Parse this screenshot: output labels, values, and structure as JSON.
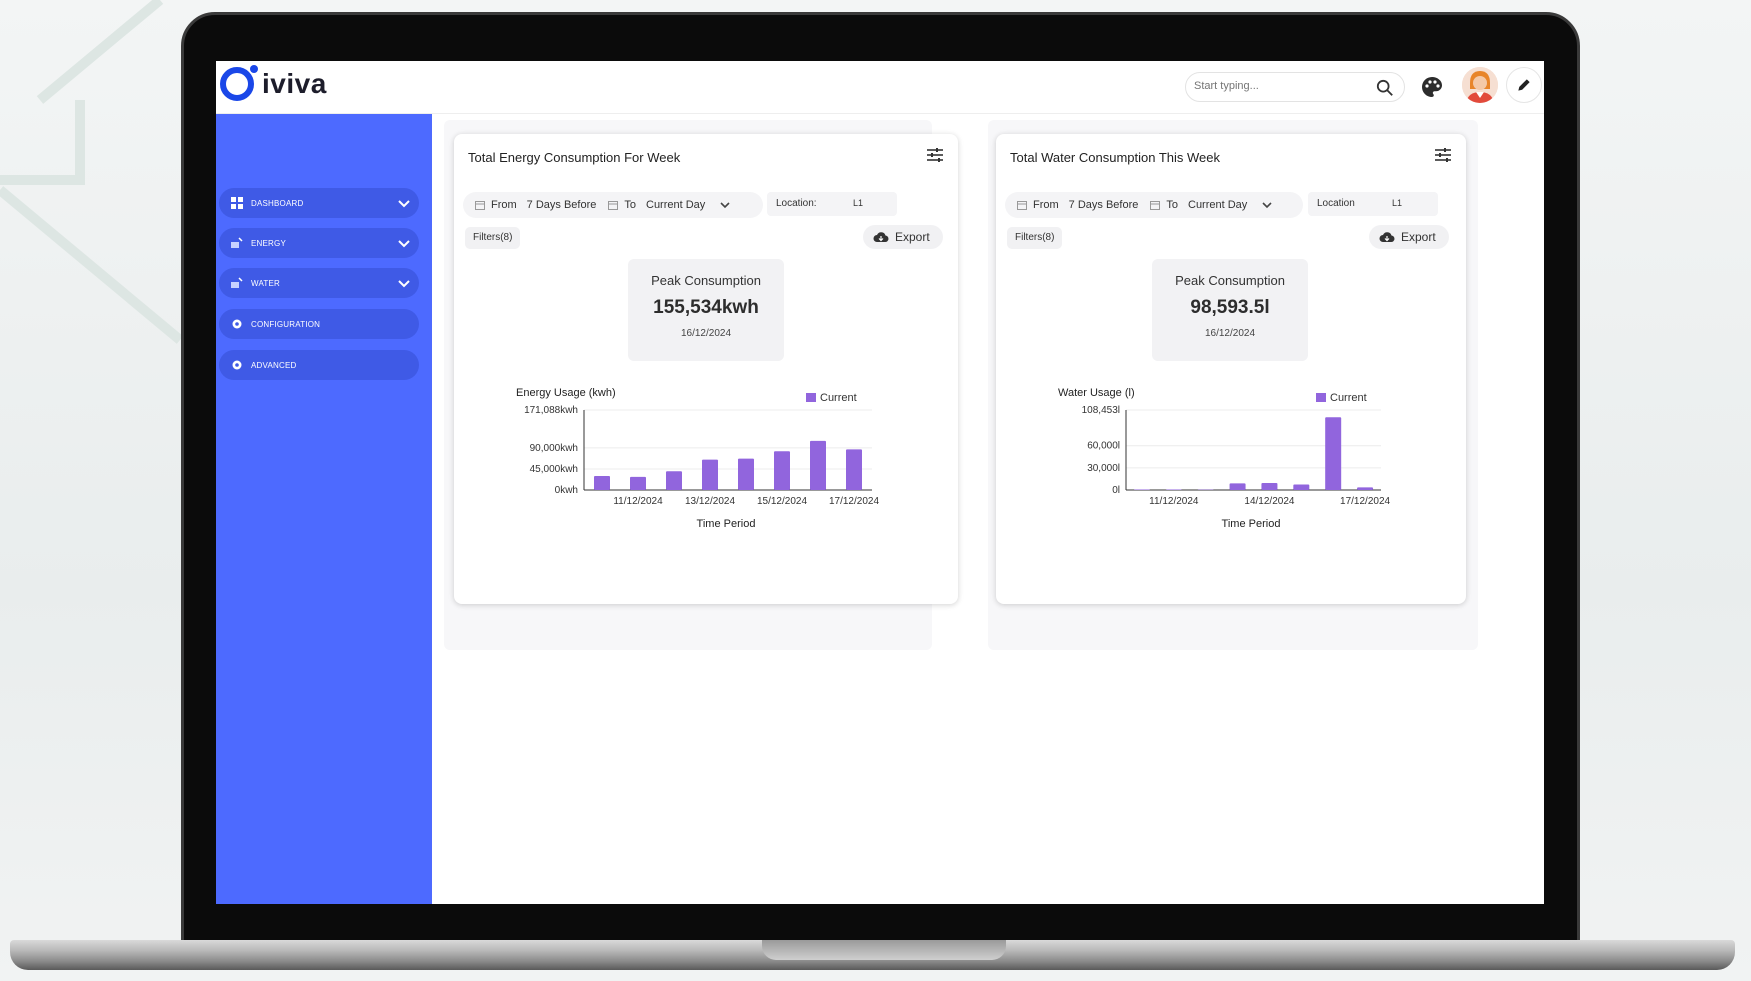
{
  "app": {
    "logo_text": "iviva",
    "accent": "#1a47e8",
    "sidebar_color": "#4d6aff",
    "bar_color": "#9165dd"
  },
  "header": {
    "search_placeholder": "Start typing..."
  },
  "sidebar": {
    "items": [
      {
        "label": "DASHBOARD",
        "icon": "grid-icon",
        "has_chevron": true
      },
      {
        "label": "ENERGY",
        "icon": "energy-icon",
        "has_chevron": true
      },
      {
        "label": "WATER",
        "icon": "water-icon",
        "has_chevron": true
      },
      {
        "label": "CONFIGURATION",
        "icon": "gear-icon",
        "has_chevron": false
      },
      {
        "label": "ADVANCED",
        "icon": "gear-icon",
        "has_chevron": false
      }
    ]
  },
  "cards": [
    {
      "title": "Total Energy Consumption For Week",
      "from_label": "From",
      "from_value": "7 Days Before",
      "to_label": "To",
      "to_value": "Current Day",
      "location_label": "Location:",
      "location_value": "L1",
      "filters": "Filters(8)",
      "export": "Export",
      "peak_label": "Peak Consumption",
      "peak_value": "155,534kwh",
      "peak_date": "16/12/2024"
    },
    {
      "title": "Total Water Consumption This Week",
      "from_label": "From",
      "from_value": "7 Days Before",
      "to_label": "To",
      "to_value": "Current Day",
      "location_label": "Location",
      "location_value": "L1",
      "filters": "Filters(8)",
      "export": "Export",
      "peak_label": "Peak Consumption",
      "peak_value": "98,593.5l",
      "peak_date": "16/12/2024"
    }
  ],
  "chart_data": [
    {
      "type": "bar",
      "title": "Energy Usage (kwh)",
      "xlabel": "Time Period",
      "ylabel": "Energy Usage (kwh)",
      "legend": "top-right",
      "series": [
        {
          "name": "Current",
          "values": [
            30000,
            28000,
            40000,
            65000,
            67000,
            83000,
            105000,
            87000
          ]
        }
      ],
      "x_ticks": [
        "11/12/2024",
        "13/12/2024",
        "15/12/2024",
        "17/12/2024"
      ],
      "y_ticks": [
        "0kwh",
        "45,000kwh",
        "90,000kwh",
        "171,088kwh"
      ],
      "ylim": [
        0,
        171088
      ]
    },
    {
      "type": "bar",
      "title": "Water Usage (l)",
      "xlabel": "Time Period",
      "ylabel": "Water Usage (l)",
      "legend": "top-right",
      "series": [
        {
          "name": "Current",
          "values": [
            700,
            600,
            500,
            9000,
            9500,
            7500,
            98593.5,
            3500
          ]
        }
      ],
      "x_ticks": [
        "11/12/2024",
        "14/12/2024",
        "17/12/2024"
      ],
      "y_ticks": [
        "0l",
        "30,000l",
        "60,000l",
        "108,453l"
      ],
      "ylim": [
        0,
        108453
      ]
    }
  ]
}
